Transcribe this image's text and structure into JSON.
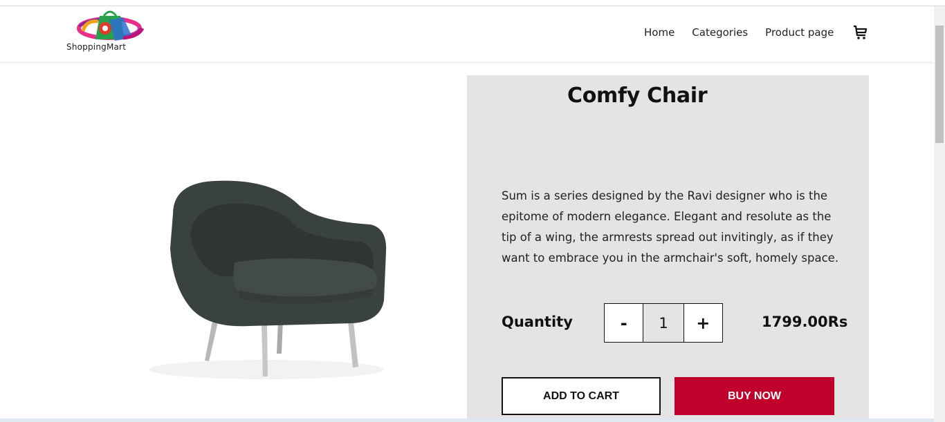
{
  "header": {
    "logo_text": "ShoppingMart",
    "nav": [
      {
        "label": "Home"
      },
      {
        "label": "Categories"
      },
      {
        "label": "Product page"
      }
    ],
    "cart_icon": "cart-icon"
  },
  "product": {
    "title": "Comfy Chair",
    "description": "Sum is a series designed by the Ravi designer who is the epitome of modern elegance. Elegant and resolute as the tip of a wing, the armrests spread out invitingly, as if they want to embrace you in the armchair's soft, homely space.",
    "quantity_label": "Quantity",
    "quantity": "1",
    "decrement_label": "-",
    "increment_label": "+",
    "price": "1799.00Rs",
    "add_to_cart_label": "ADD TO CART",
    "buy_now_label": "BUY NOW"
  },
  "colors": {
    "panel_bg": "#e4e4e4",
    "buy_button": "#c0002a",
    "text": "#111111"
  }
}
